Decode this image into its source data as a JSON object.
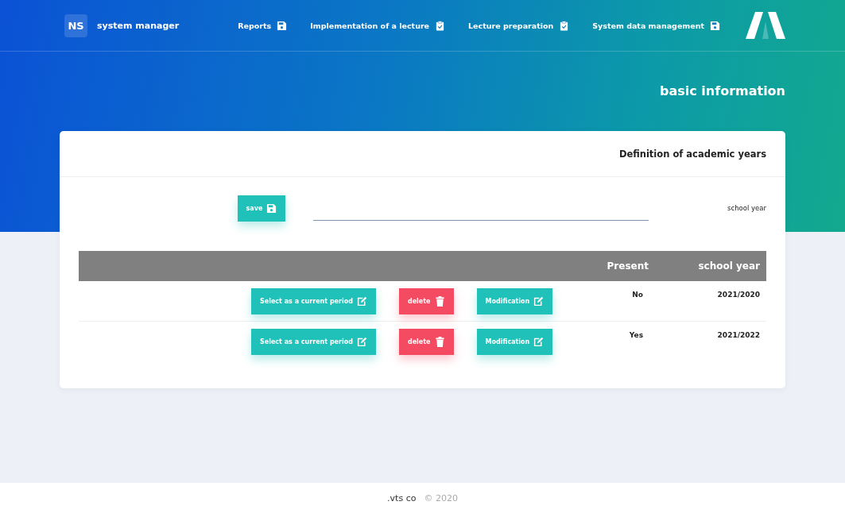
{
  "brand": {
    "initials": "NS",
    "name": "system manager"
  },
  "nav": [
    {
      "label": "Reports",
      "kind": "save"
    },
    {
      "label": "Implementation of a lecture",
      "kind": "check"
    },
    {
      "label": "Lecture preparation",
      "kind": "check"
    },
    {
      "label": "System data management",
      "kind": "save"
    }
  ],
  "page_title": "basic information",
  "card": {
    "title": "Definition of academic years",
    "form": {
      "save_button": "save",
      "field_label": "school year"
    },
    "table": {
      "columns": [
        "Present",
        "school year"
      ],
      "rows": [
        {
          "select": "Select as a current period",
          "delete": "delete",
          "modify": "Modification",
          "present": "No",
          "school_year": "2021/2020"
        },
        {
          "select": "Select as a current period",
          "delete": "delete",
          "modify": "Modification",
          "present": "Yes",
          "school_year": "2021/2022"
        }
      ]
    }
  },
  "footer": {
    "company": ".vts co",
    "copyright": "© 2020"
  }
}
